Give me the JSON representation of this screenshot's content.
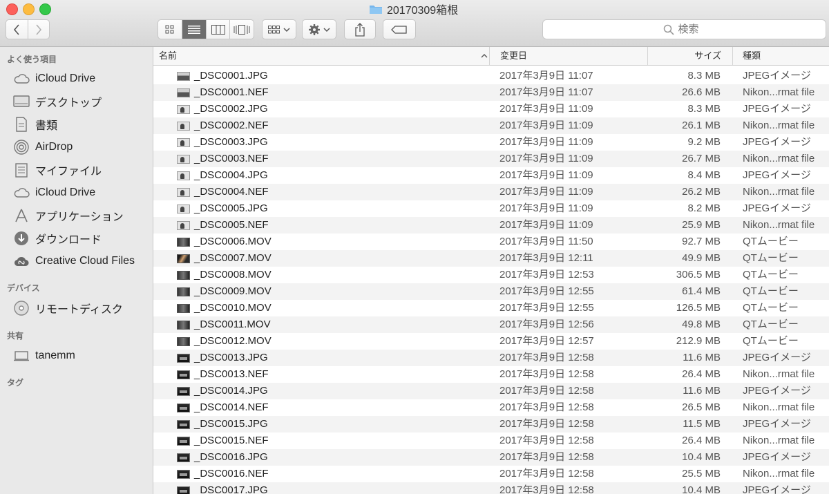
{
  "window": {
    "title": "20170309箱根"
  },
  "toolbar": {
    "search_placeholder": "検索"
  },
  "sidebar": {
    "favorites_header": "よく使う項目",
    "favorites": [
      {
        "label": "iCloud Drive",
        "icon": "cloud-icon"
      },
      {
        "label": "デスクトップ",
        "icon": "desktop-icon"
      },
      {
        "label": "書類",
        "icon": "document-icon"
      },
      {
        "label": "AirDrop",
        "icon": "airdrop-icon"
      },
      {
        "label": "マイファイル",
        "icon": "all-files-icon"
      },
      {
        "label": "iCloud Drive",
        "icon": "cloud-icon"
      },
      {
        "label": "アプリケーション",
        "icon": "applications-icon"
      },
      {
        "label": "ダウンロード",
        "icon": "download-icon"
      },
      {
        "label": "Creative Cloud Files",
        "icon": "creative-cloud-icon"
      }
    ],
    "devices_header": "デバイス",
    "devices": [
      {
        "label": "リモートディスク",
        "icon": "disc-icon"
      }
    ],
    "shared_header": "共有",
    "shared": [
      {
        "label": "tanemm",
        "icon": "computer-icon"
      }
    ],
    "tags_header": "タグ"
  },
  "list": {
    "columns": {
      "name": "名前",
      "date": "変更日",
      "size": "サイズ",
      "kind": "種類"
    },
    "sort": {
      "column": "name",
      "direction": "ascending"
    },
    "rows": [
      {
        "name": "_DSC0001.JPG",
        "date": "2017年3月9日 11:07",
        "size": "8.3 MB",
        "kind": "JPEGイメージ",
        "thumb": "photo"
      },
      {
        "name": "_DSC0001.NEF",
        "date": "2017年3月9日 11:07",
        "size": "26.6 MB",
        "kind": "Nikon...rmat file",
        "thumb": "photo"
      },
      {
        "name": "_DSC0002.JPG",
        "date": "2017年3月9日 11:09",
        "size": "8.3 MB",
        "kind": "JPEGイメージ",
        "thumb": "portrait"
      },
      {
        "name": "_DSC0002.NEF",
        "date": "2017年3月9日 11:09",
        "size": "26.1 MB",
        "kind": "Nikon...rmat file",
        "thumb": "portrait"
      },
      {
        "name": "_DSC0003.JPG",
        "date": "2017年3月9日 11:09",
        "size": "9.2 MB",
        "kind": "JPEGイメージ",
        "thumb": "portrait"
      },
      {
        "name": "_DSC0003.NEF",
        "date": "2017年3月9日 11:09",
        "size": "26.7 MB",
        "kind": "Nikon...rmat file",
        "thumb": "portrait"
      },
      {
        "name": "_DSC0004.JPG",
        "date": "2017年3月9日 11:09",
        "size": "8.4 MB",
        "kind": "JPEGイメージ",
        "thumb": "portrait"
      },
      {
        "name": "_DSC0004.NEF",
        "date": "2017年3月9日 11:09",
        "size": "26.2 MB",
        "kind": "Nikon...rmat file",
        "thumb": "portrait"
      },
      {
        "name": "_DSC0005.JPG",
        "date": "2017年3月9日 11:09",
        "size": "8.2 MB",
        "kind": "JPEGイメージ",
        "thumb": "portrait"
      },
      {
        "name": "_DSC0005.NEF",
        "date": "2017年3月9日 11:09",
        "size": "25.9 MB",
        "kind": "Nikon...rmat file",
        "thumb": "portrait"
      },
      {
        "name": "_DSC0006.MOV",
        "date": "2017年3月9日 11:50",
        "size": "92.7 MB",
        "kind": "QTムービー",
        "thumb": "movie"
      },
      {
        "name": "_DSC0007.MOV",
        "date": "2017年3月9日 12:11",
        "size": "49.9 MB",
        "kind": "QTムービー",
        "thumb": "movie2"
      },
      {
        "name": "_DSC0008.MOV",
        "date": "2017年3月9日 12:53",
        "size": "306.5 MB",
        "kind": "QTムービー",
        "thumb": "movie"
      },
      {
        "name": "_DSC0009.MOV",
        "date": "2017年3月9日 12:55",
        "size": "61.4 MB",
        "kind": "QTムービー",
        "thumb": "movie"
      },
      {
        "name": "_DSC0010.MOV",
        "date": "2017年3月9日 12:55",
        "size": "126.5 MB",
        "kind": "QTムービー",
        "thumb": "movie"
      },
      {
        "name": "_DSC0011.MOV",
        "date": "2017年3月9日 12:56",
        "size": "49.8 MB",
        "kind": "QTムービー",
        "thumb": "movie"
      },
      {
        "name": "_DSC0012.MOV",
        "date": "2017年3月9日 12:57",
        "size": "212.9 MB",
        "kind": "QTムービー",
        "thumb": "movie"
      },
      {
        "name": "_DSC0013.JPG",
        "date": "2017年3月9日 12:58",
        "size": "11.6 MB",
        "kind": "JPEGイメージ",
        "thumb": "dark"
      },
      {
        "name": "_DSC0013.NEF",
        "date": "2017年3月9日 12:58",
        "size": "26.4 MB",
        "kind": "Nikon...rmat file",
        "thumb": "dark"
      },
      {
        "name": "_DSC0014.JPG",
        "date": "2017年3月9日 12:58",
        "size": "11.6 MB",
        "kind": "JPEGイメージ",
        "thumb": "dark"
      },
      {
        "name": "_DSC0014.NEF",
        "date": "2017年3月9日 12:58",
        "size": "26.5 MB",
        "kind": "Nikon...rmat file",
        "thumb": "dark"
      },
      {
        "name": "_DSC0015.JPG",
        "date": "2017年3月9日 12:58",
        "size": "11.5 MB",
        "kind": "JPEGイメージ",
        "thumb": "dark"
      },
      {
        "name": "_DSC0015.NEF",
        "date": "2017年3月9日 12:58",
        "size": "26.4 MB",
        "kind": "Nikon...rmat file",
        "thumb": "dark"
      },
      {
        "name": "_DSC0016.JPG",
        "date": "2017年3月9日 12:58",
        "size": "10.4 MB",
        "kind": "JPEGイメージ",
        "thumb": "dark"
      },
      {
        "name": "_DSC0016.NEF",
        "date": "2017年3月9日 12:58",
        "size": "25.5 MB",
        "kind": "Nikon...rmat file",
        "thumb": "dark"
      },
      {
        "name": "_DSC0017.JPG",
        "date": "2017年3月9日 12:58",
        "size": "10.4 MB",
        "kind": "JPEGイメージ",
        "thumb": "dark"
      }
    ]
  }
}
